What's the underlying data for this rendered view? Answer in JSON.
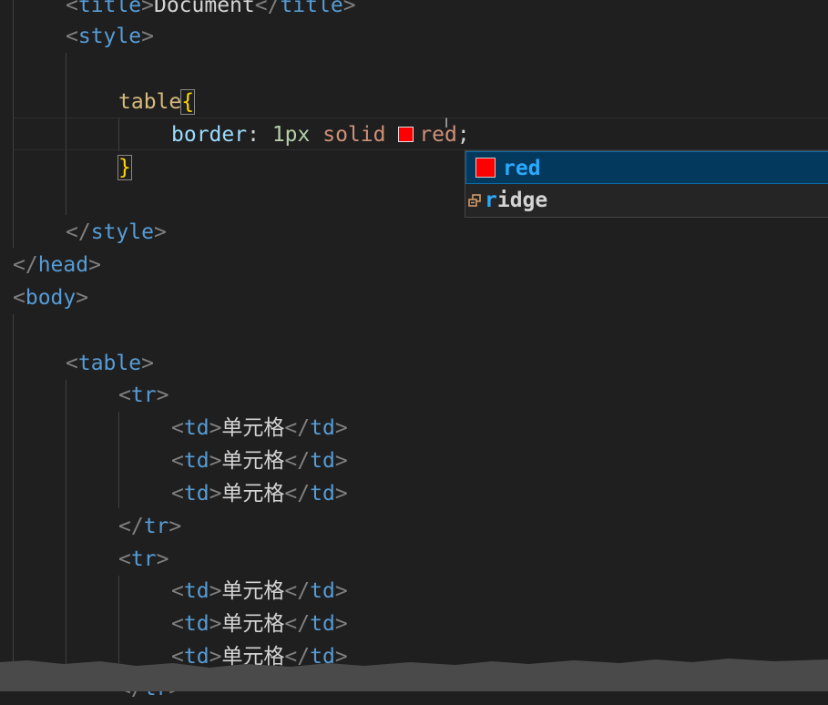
{
  "code": {
    "line_title": {
      "open": "<title>",
      "text": "Document",
      "close": "</title>",
      "open_tag": "title",
      "close_tag": "title"
    },
    "style_open_tag": "style",
    "selector": "table",
    "brace_open": "{",
    "brace_close": "}",
    "property": "border",
    "colon": ":",
    "value_width": "1px",
    "value_style": "solid",
    "value_color": "red",
    "semicolon": ";",
    "style_close_tag": "style",
    "head_close_tag": "head",
    "body_open_tag": "body",
    "table_open_tag": "table",
    "tr_tag": "tr",
    "td_tag": "td",
    "cell_text": "单元格"
  },
  "suggest": {
    "items": [
      {
        "match": "red",
        "rest": "",
        "icon": "color-swatch-icon",
        "color": "#ff0000"
      },
      {
        "match": "r",
        "rest": "idge",
        "icon": "enum-value-icon"
      }
    ]
  },
  "colors": {
    "background": "#1f1f1f",
    "tag": "#569cd6",
    "selector": "#d7ba7d",
    "property": "#9cdcfe",
    "number": "#b5cea8",
    "string_value": "#ce9178",
    "suggest_highlight": "#2aaaff",
    "suggest_selected_bg": "#04395e"
  }
}
